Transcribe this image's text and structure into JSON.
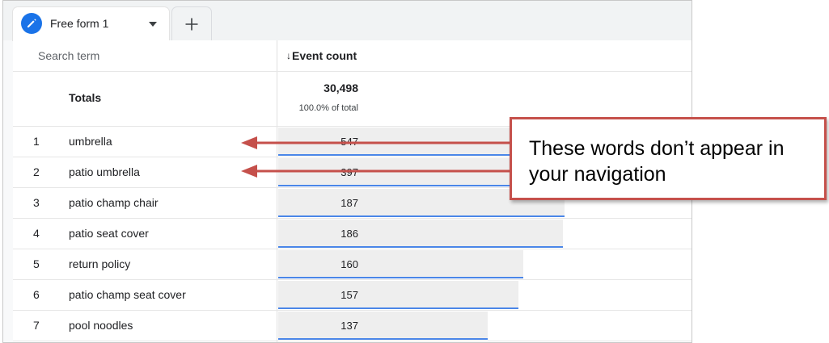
{
  "tabs": {
    "active_label": "Free form 1"
  },
  "table": {
    "header_term": "Search term",
    "header_count": "Event count",
    "totals_label": "Totals",
    "totals_value": "30,498",
    "totals_sub": "100.0% of total",
    "rows": [
      {
        "rank": "1",
        "term": "umbrella",
        "count": "547",
        "value": 547
      },
      {
        "rank": "2",
        "term": "patio umbrella",
        "count": "397",
        "value": 397
      },
      {
        "rank": "3",
        "term": "patio champ chair",
        "count": "187",
        "value": 187
      },
      {
        "rank": "4",
        "term": "patio seat cover",
        "count": "186",
        "value": 186
      },
      {
        "rank": "5",
        "term": "return policy",
        "count": "160",
        "value": 160
      },
      {
        "rank": "6",
        "term": "patio champ seat cover",
        "count": "157",
        "value": 157
      },
      {
        "rank": "7",
        "term": "pool noodles",
        "count": "137",
        "value": 137
      }
    ]
  },
  "callout": {
    "text": "These words don’t appear in your navigation"
  },
  "colors": {
    "accent_blue": "#1a73e8",
    "bar_line": "#4a86e8",
    "bar_fill": "#eeeeee",
    "callout_red": "#c5504b"
  },
  "icons": {
    "tab_icon": "pencil-icon",
    "tab_dropdown": "caret-down-icon",
    "add_tab": "plus-icon",
    "sort": "arrow-down-icon"
  }
}
